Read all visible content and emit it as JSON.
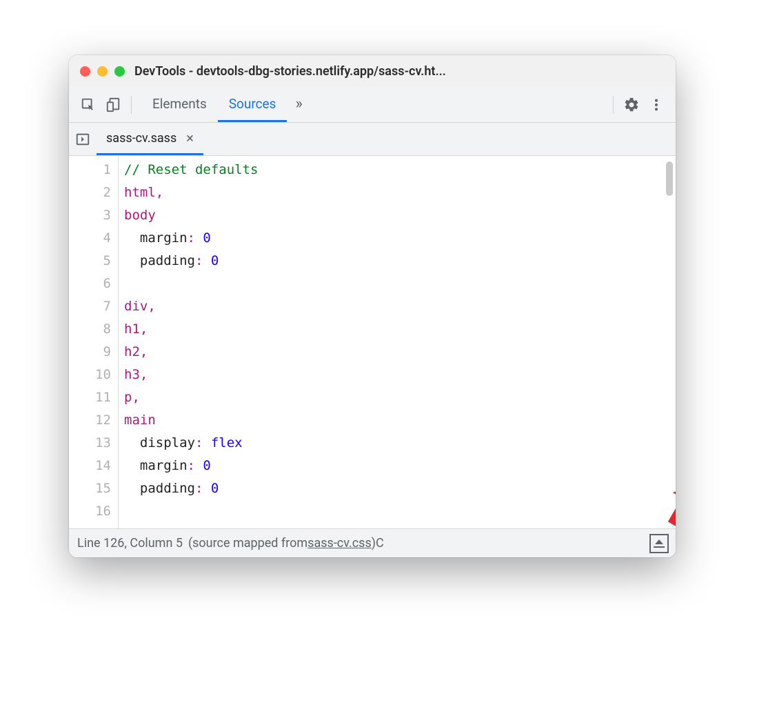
{
  "window": {
    "title": "DevTools - devtools-dbg-stories.netlify.app/sass-cv.ht..."
  },
  "toolbar": {
    "tabs": [
      {
        "label": "Elements",
        "active": false
      },
      {
        "label": "Sources",
        "active": true
      }
    ],
    "overflow": "»"
  },
  "fileTabs": [
    {
      "name": "sass-cv.sass",
      "active": true
    }
  ],
  "editor": {
    "lines": [
      {
        "n": "1",
        "tokens": [
          [
            "cm",
            "// Reset defaults"
          ]
        ]
      },
      {
        "n": "2",
        "tokens": [
          [
            "sel",
            "html"
          ],
          [
            "pun",
            ","
          ]
        ]
      },
      {
        "n": "3",
        "tokens": [
          [
            "sel",
            "body"
          ]
        ]
      },
      {
        "n": "4",
        "tokens": [
          [
            "prop",
            "  margin"
          ],
          [
            "pun",
            ": "
          ],
          [
            "val",
            "0"
          ]
        ]
      },
      {
        "n": "5",
        "tokens": [
          [
            "prop",
            "  padding"
          ],
          [
            "pun",
            ": "
          ],
          [
            "val",
            "0"
          ]
        ]
      },
      {
        "n": "6",
        "tokens": []
      },
      {
        "n": "7",
        "tokens": [
          [
            "sel",
            "div"
          ],
          [
            "pun",
            ","
          ]
        ]
      },
      {
        "n": "8",
        "tokens": [
          [
            "sel",
            "h1"
          ],
          [
            "pun",
            ","
          ]
        ]
      },
      {
        "n": "9",
        "tokens": [
          [
            "sel",
            "h2"
          ],
          [
            "pun",
            ","
          ]
        ]
      },
      {
        "n": "10",
        "tokens": [
          [
            "sel",
            "h3"
          ],
          [
            "pun",
            ","
          ]
        ]
      },
      {
        "n": "11",
        "tokens": [
          [
            "sel",
            "p"
          ],
          [
            "pun",
            ","
          ]
        ]
      },
      {
        "n": "12",
        "tokens": [
          [
            "sel",
            "main"
          ]
        ]
      },
      {
        "n": "13",
        "tokens": [
          [
            "prop",
            "  display"
          ],
          [
            "pun",
            ": "
          ],
          [
            "kw",
            "flex"
          ]
        ]
      },
      {
        "n": "14",
        "tokens": [
          [
            "prop",
            "  margin"
          ],
          [
            "pun",
            ": "
          ],
          [
            "val",
            "0"
          ]
        ]
      },
      {
        "n": "15",
        "tokens": [
          [
            "prop",
            "  padding"
          ],
          [
            "pun",
            ": "
          ],
          [
            "val",
            "0"
          ]
        ]
      },
      {
        "n": "16",
        "tokens": []
      }
    ]
  },
  "statusbar": {
    "position": "Line 126, Column 5",
    "mapped_prefix": "(source mapped from ",
    "mapped_file": "sass-cv.css",
    "mapped_suffix": ")",
    "trail": " C"
  }
}
